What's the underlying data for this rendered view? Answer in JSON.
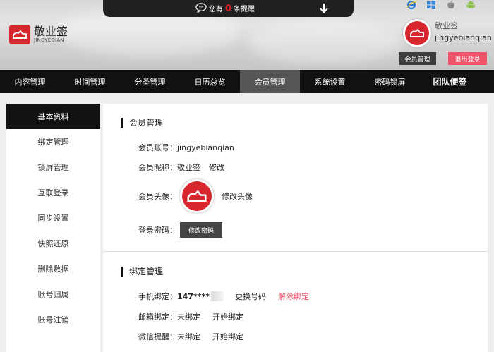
{
  "notice": {
    "prefix": "您有",
    "count": "0",
    "suffix": "条提醒"
  },
  "brand": {
    "name_cn": "敬业签",
    "name_en": "JINGYEQIAN"
  },
  "platforms": [
    "ie-icon",
    "windows-icon",
    "apple-icon",
    "android-icon"
  ],
  "user": {
    "nickname": "敬业签",
    "account": "jingyebianqian"
  },
  "header_buttons": {
    "member": "会员管理",
    "logout": "退出登录"
  },
  "nav": [
    "内容管理",
    "时间管理",
    "分类管理",
    "日历总览",
    "会员管理",
    "系统设置",
    "密码锁屏",
    "团队便签"
  ],
  "nav_active": "会员管理",
  "sidebar": [
    "基本资料",
    "绑定管理",
    "锁屏管理",
    "互联登录",
    "同步设置",
    "快照还原",
    "删除数据",
    "账号归属",
    "账号注销"
  ],
  "member_section": {
    "title": "会员管理",
    "account_label": "会员账号：",
    "account_value": "jingyebianqian",
    "nickname_label": "会员昵称：",
    "nickname_value": "敬业签",
    "nickname_edit": "修改",
    "avatar_label": "会员头像：",
    "avatar_edit": "修改头像",
    "password_label": "登录密码：",
    "password_button": "修改密码"
  },
  "binding_section": {
    "title": "绑定管理",
    "phone_label": "手机绑定：",
    "phone_value": "147****",
    "phone_change": "更换号码",
    "phone_unbind": "解除绑定",
    "email_label": "邮箱绑定：",
    "email_value": "未绑定",
    "email_action": "开始绑定",
    "wechat_label": "微信提醒：",
    "wechat_value": "未绑定",
    "wechat_action": "开始绑定"
  },
  "colors": {
    "brand_red": "#d7262e",
    "logout_pink": "#f05468",
    "nav_bg": "#111111",
    "nav_active": "#555555"
  }
}
